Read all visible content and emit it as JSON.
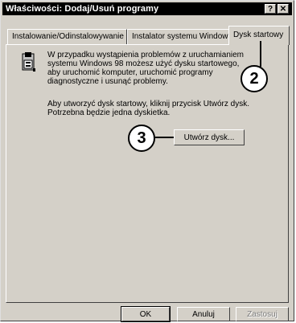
{
  "window": {
    "title": "Właściwości: Dodaj/Usuń programy",
    "help_btn": "?",
    "close_btn": "✕"
  },
  "tabs": [
    {
      "label": "Instalowanie/Odinstalowywanie",
      "active": false
    },
    {
      "label": "Instalator systemu Windows",
      "active": false
    },
    {
      "label": "Dysk startowy",
      "active": true
    }
  ],
  "panel": {
    "icon": "startup-disk-icon",
    "description": "W przypadku wystąpienia problemów z uruchamianiem\nsystemu Windows 98 możesz użyć dysku startowego,\naby uruchomić komputer, uruchomić programy\ndiagnostyczne i usunąć problemy.",
    "instruction": "Aby utworzyć dysk startowy, kliknij przycisk Utwórz dysk.\nPotrzebna będzie jedna dyskietka.",
    "create_button": "Utwórz dysk..."
  },
  "footer": {
    "ok": "OK",
    "cancel": "Anuluj",
    "apply": "Zastosuj"
  },
  "callouts": {
    "tab_marker": "2",
    "button_marker": "3"
  }
}
